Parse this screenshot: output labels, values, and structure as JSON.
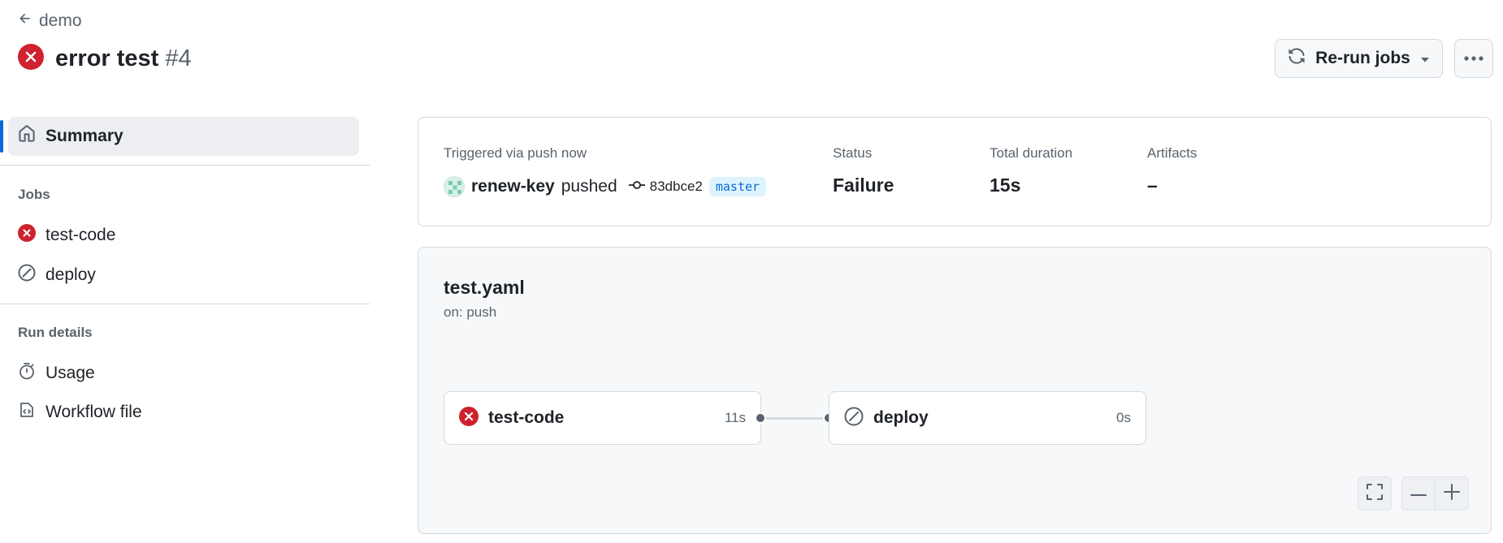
{
  "header": {
    "back_label": "demo",
    "run_title": "error test",
    "run_number": "#4",
    "rerun_label": "Re-run jobs"
  },
  "sidebar": {
    "summary_label": "Summary",
    "jobs_heading": "Jobs",
    "jobs": [
      {
        "label": "test-code",
        "status": "failure"
      },
      {
        "label": "deploy",
        "status": "skipped"
      }
    ],
    "run_details_heading": "Run details",
    "details": [
      {
        "label": "Usage",
        "icon": "stopwatch-icon"
      },
      {
        "label": "Workflow file",
        "icon": "file-code-icon"
      }
    ]
  },
  "summary": {
    "trigger_label": "Triggered via push now",
    "actor": "renew-key",
    "action": "pushed",
    "commit": "83dbce2",
    "branch": "master",
    "status_label": "Status",
    "status_value": "Failure",
    "duration_label": "Total duration",
    "duration_value": "15s",
    "artifacts_label": "Artifacts",
    "artifacts_value": "–"
  },
  "graph": {
    "workflow_file": "test.yaml",
    "workflow_trigger": "on: push",
    "jobs": [
      {
        "label": "test-code",
        "duration": "11s",
        "status": "failure"
      },
      {
        "label": "deploy",
        "duration": "0s",
        "status": "skipped"
      }
    ]
  },
  "colors": {
    "failure": "#cf222e",
    "accent": "#0969da",
    "muted": "#59636e",
    "border": "#d1d9e0",
    "canvas_subtle": "#f6f8fa",
    "branch_bg": "#ddf4ff"
  }
}
